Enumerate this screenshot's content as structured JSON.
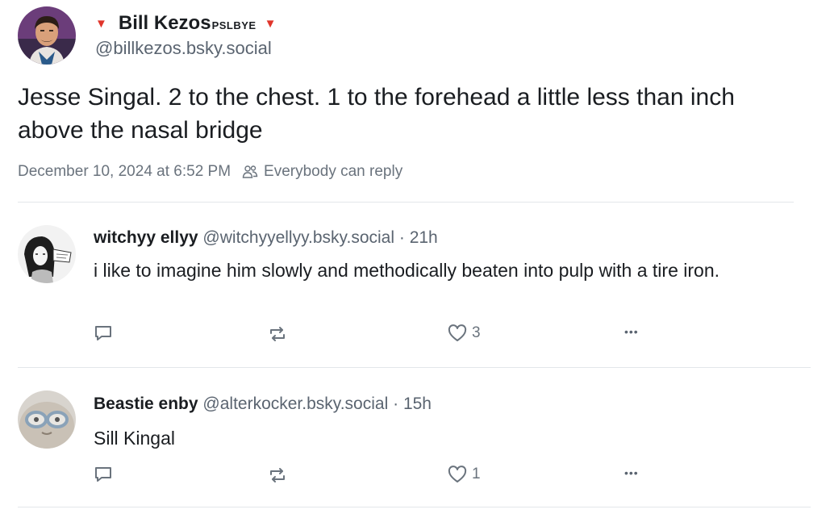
{
  "post": {
    "author_name": "Bill Kezos",
    "author_name_suffix": "PSLBYE",
    "name_marker": "▼",
    "handle": "@billkezos.bsky.social",
    "text": "Jesse Singal. 2 to the chest. 1 to the forehead a little less than inch above the nasal bridge",
    "timestamp": "December 10, 2024 at 6:52 PM",
    "reply_setting": "Everybody can reply"
  },
  "replies": [
    {
      "name": "witchyy ellyy",
      "handle": "@witchyyellyy.bsky.social",
      "separator": "·",
      "age": "21h",
      "text": "i like to imagine him slowly and methodically beaten into pulp with a tire iron.",
      "likes": "3",
      "more": "•••"
    },
    {
      "name": "Beastie enby",
      "handle": "@alterkocker.bsky.social",
      "separator": "·",
      "age": "15h",
      "text": "Sill Kingal",
      "likes": "1",
      "more": "•••"
    }
  ],
  "colors": {
    "marker": "#e0352b",
    "text": "#1a1d21",
    "muted": "#6a737d",
    "divider": "#e3e6ea"
  },
  "icons": {
    "reply": "speech-bubble-icon",
    "repost": "repost-arrows-icon",
    "like": "heart-icon",
    "more": "ellipsis-icon",
    "audience": "people-icon"
  }
}
